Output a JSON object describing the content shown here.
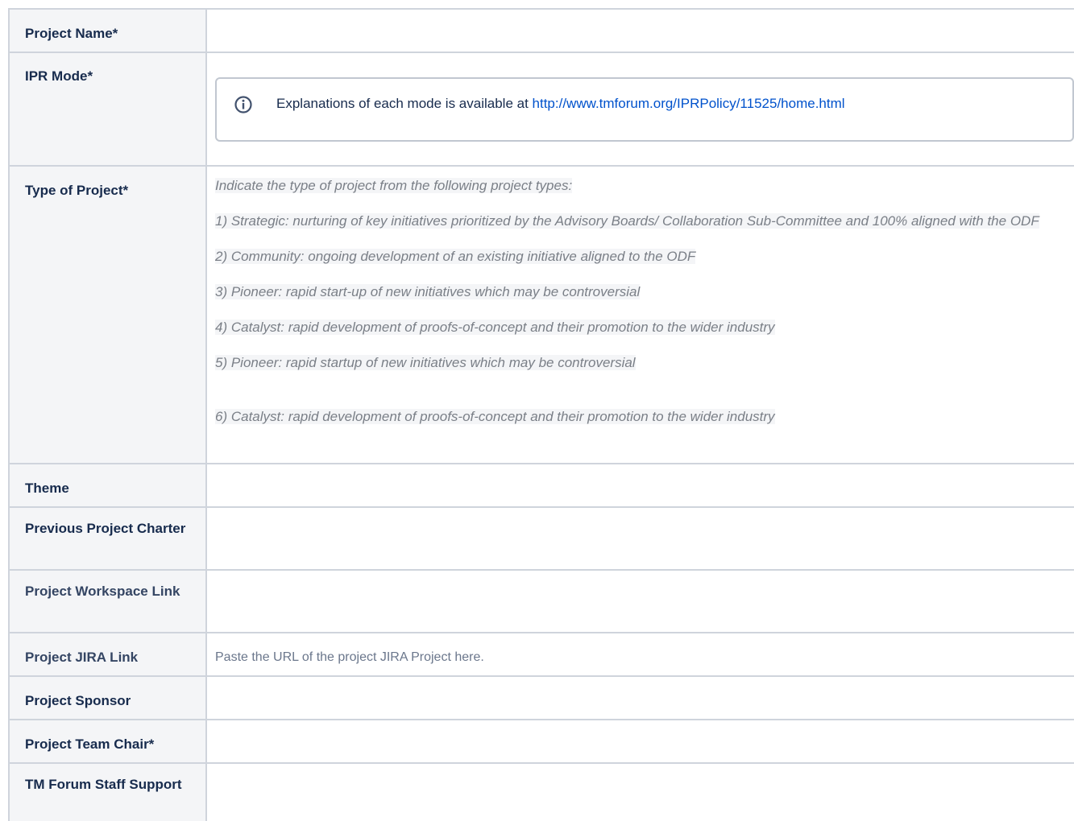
{
  "rows": {
    "project_name": {
      "label": "Project Name*"
    },
    "ipr_mode": {
      "label": "IPR Mode*",
      "info": {
        "text": "Explanations of each mode is available at ",
        "link_text": "http://www.tmforum.org/IPRPolicy/11525/home.html",
        "icon": "info-icon"
      }
    },
    "type_of_project": {
      "label": "Type of Project*",
      "items": [
        "Indicate the type of project from the following project types:",
        "1) Strategic: nurturing of key initiatives prioritized by the Advisory Boards/ Collaboration Sub-Committee and 100% aligned with the ODF",
        "2) Community: ongoing development of an existing initiative aligned to the ODF",
        "3) Pioneer: rapid start-up of new initiatives which may be controversial",
        "4) Catalyst: rapid development of proofs-of-concept and their promotion to the wider industry",
        "5) Pioneer: rapid startup of new initiatives which may be controversial",
        "6) Catalyst: rapid development of proofs-of-concept and their promotion to the wider industry"
      ]
    },
    "theme": {
      "label": "Theme"
    },
    "previous_charter": {
      "label": "Previous Project Charter"
    },
    "workspace_link": {
      "label": "Project Workspace Link"
    },
    "jira_link": {
      "label": "Project JIRA Link",
      "hint": "Paste the URL of the project JIRA Project here."
    },
    "sponsor": {
      "label": "Project Sponsor"
    },
    "team_chair": {
      "label": "Project Team Chair*"
    },
    "staff_support": {
      "label": "TM Forum Staff Support"
    }
  },
  "colors": {
    "border": "#cfd4dc",
    "label_bg": "#f4f5f7",
    "link": "#0052cc",
    "hint_text": "#6b778c"
  }
}
